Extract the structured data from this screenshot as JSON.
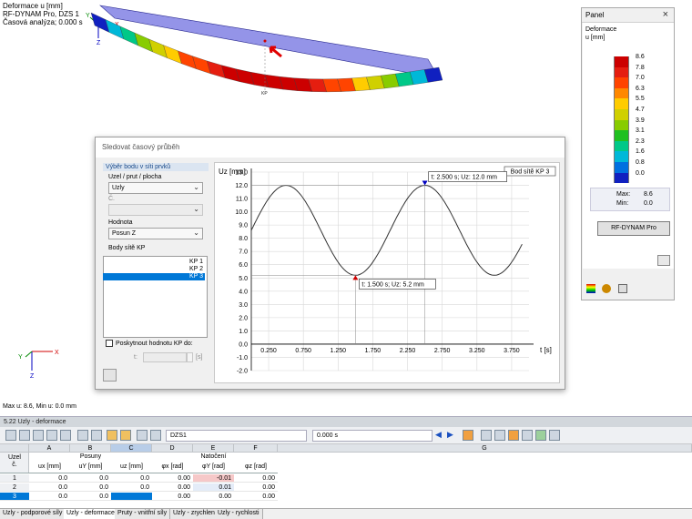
{
  "viewport": {
    "info": [
      "Deformace u [mm]",
      "RF-DYNAM Pro, DZS 1",
      "Časová analýza; 0.000 s"
    ],
    "status": "Max u: 8.6, Min u: 0.0 mm",
    "axes_top": {
      "x": "X",
      "y": "Y",
      "z": "Z"
    },
    "axes_bottom": {
      "x": "X",
      "y": "Y",
      "z": "Z"
    },
    "beam_node_label": "KP"
  },
  "panel": {
    "title": "Panel",
    "subtitle_1": "Deformace",
    "subtitle_2": "u [mm]",
    "legend": [
      {
        "value": "8.6",
        "color": "#cc0000"
      },
      {
        "value": "7.8",
        "color": "#e51e10"
      },
      {
        "value": "7.0",
        "color": "#ff4400"
      },
      {
        "value": "6.3",
        "color": "#ff8800"
      },
      {
        "value": "5.5",
        "color": "#ffcc00"
      },
      {
        "value": "4.7",
        "color": "#d0d000"
      },
      {
        "value": "3.9",
        "color": "#88cc00"
      },
      {
        "value": "3.1",
        "color": "#20c020"
      },
      {
        "value": "2.3",
        "color": "#00c888"
      },
      {
        "value": "1.6",
        "color": "#00b8d8"
      },
      {
        "value": "0.8",
        "color": "#0070e0"
      },
      {
        "value": "0.0",
        "color": "#1020c0"
      }
    ],
    "max_label": "Max:",
    "max_value": "8.6",
    "min_label": "Min:",
    "min_value": "0.0",
    "rf_button": "RF-DYNAM Pro"
  },
  "dialog": {
    "title": "Sledovat časový průběh",
    "group_title": "Výběr bodu v síti prvků",
    "node_label": "Uzel / prut / plocha",
    "node_value": "Uzly",
    "no_label": "Č.",
    "no_value": "",
    "value_label": "Hodnota",
    "value_value": "Posun Z",
    "mesh_points_label": "Body sítě KP",
    "mesh_points": [
      "KP 1",
      "KP 2",
      "KP 3"
    ],
    "selected_point": 2,
    "checkbox_label": "Poskytnout hodnotu KP do:",
    "t_label": "t:",
    "t_unit": "[s]"
  },
  "chart_data": {
    "type": "line",
    "title": "Bod sítě KP 3",
    "ylabel": "Uz [mm]",
    "xlabel": "t [s]",
    "xlim": [
      0.0,
      4.0
    ],
    "ylim": [
      -2.0,
      13.0
    ],
    "xticks": [
      "0.250",
      "0.750",
      "1.250",
      "1.750",
      "2.250",
      "2.750",
      "3.250",
      "3.750"
    ],
    "yticks": [
      "13.0",
      "12.0",
      "11.0",
      "10.0",
      "9.0",
      "8.0",
      "7.0",
      "6.0",
      "5.0",
      "4.0",
      "3.0",
      "2.0",
      "1.0",
      "0.0",
      "-1.0",
      "-2.0"
    ],
    "grid": true,
    "series": [
      {
        "x": [
          0.0,
          0.25,
          0.5,
          0.75,
          1.0,
          1.25,
          1.5,
          1.75,
          2.0,
          2.25,
          2.5,
          2.75,
          3.0,
          3.25,
          3.5,
          3.75,
          3.9
        ],
        "values": [
          8.6,
          11.4,
          12.0,
          11.4,
          9.0,
          6.2,
          5.2,
          6.2,
          9.0,
          11.4,
          12.0,
          11.4,
          9.0,
          6.2,
          5.2,
          6.2,
          8.6
        ]
      }
    ],
    "annotations": [
      {
        "text": "t: 2.500 s; Uz: 12.0 mm",
        "x": 2.5,
        "y": 12.0,
        "kind": "max"
      },
      {
        "text": "t: 1.500 s; Uz: 5.2 mm",
        "x": 1.5,
        "y": 5.2,
        "kind": "min"
      }
    ]
  },
  "table": {
    "header": "5.22 Uzly - deformace",
    "load_case": "DZS1",
    "time": "0.000 s",
    "col_letters": [
      "A",
      "B",
      "C",
      "D",
      "E",
      "F",
      "G"
    ],
    "node_head_1": "Uzel",
    "node_head_2": "č.",
    "group_posuny": "Posuny",
    "group_natoceni": "Natočení",
    "col_units": [
      "ux [mm]",
      "uY [mm]",
      "uz [mm]",
      "φx [rad]",
      "φY [rad]",
      "φz [rad]"
    ],
    "rows": [
      {
        "no": "1",
        "vals": [
          "0.0",
          "0.0",
          "0.0",
          "0.00",
          "-0.01",
          "0.00"
        ]
      },
      {
        "no": "2",
        "vals": [
          "0.0",
          "0.0",
          "0.0",
          "0.00",
          "0.01",
          "0.00"
        ]
      },
      {
        "no": "3",
        "vals": [
          "0.0",
          "0.0",
          "",
          "0.00",
          "0.00",
          "0.00"
        ]
      }
    ],
    "tabs": [
      "Uzly - podporové síly",
      "Uzly - deformace",
      "Pruty - vnitřní síly",
      "Uzly - zrychlení",
      "Uzly - rychlosti"
    ],
    "active_tab": 1
  }
}
